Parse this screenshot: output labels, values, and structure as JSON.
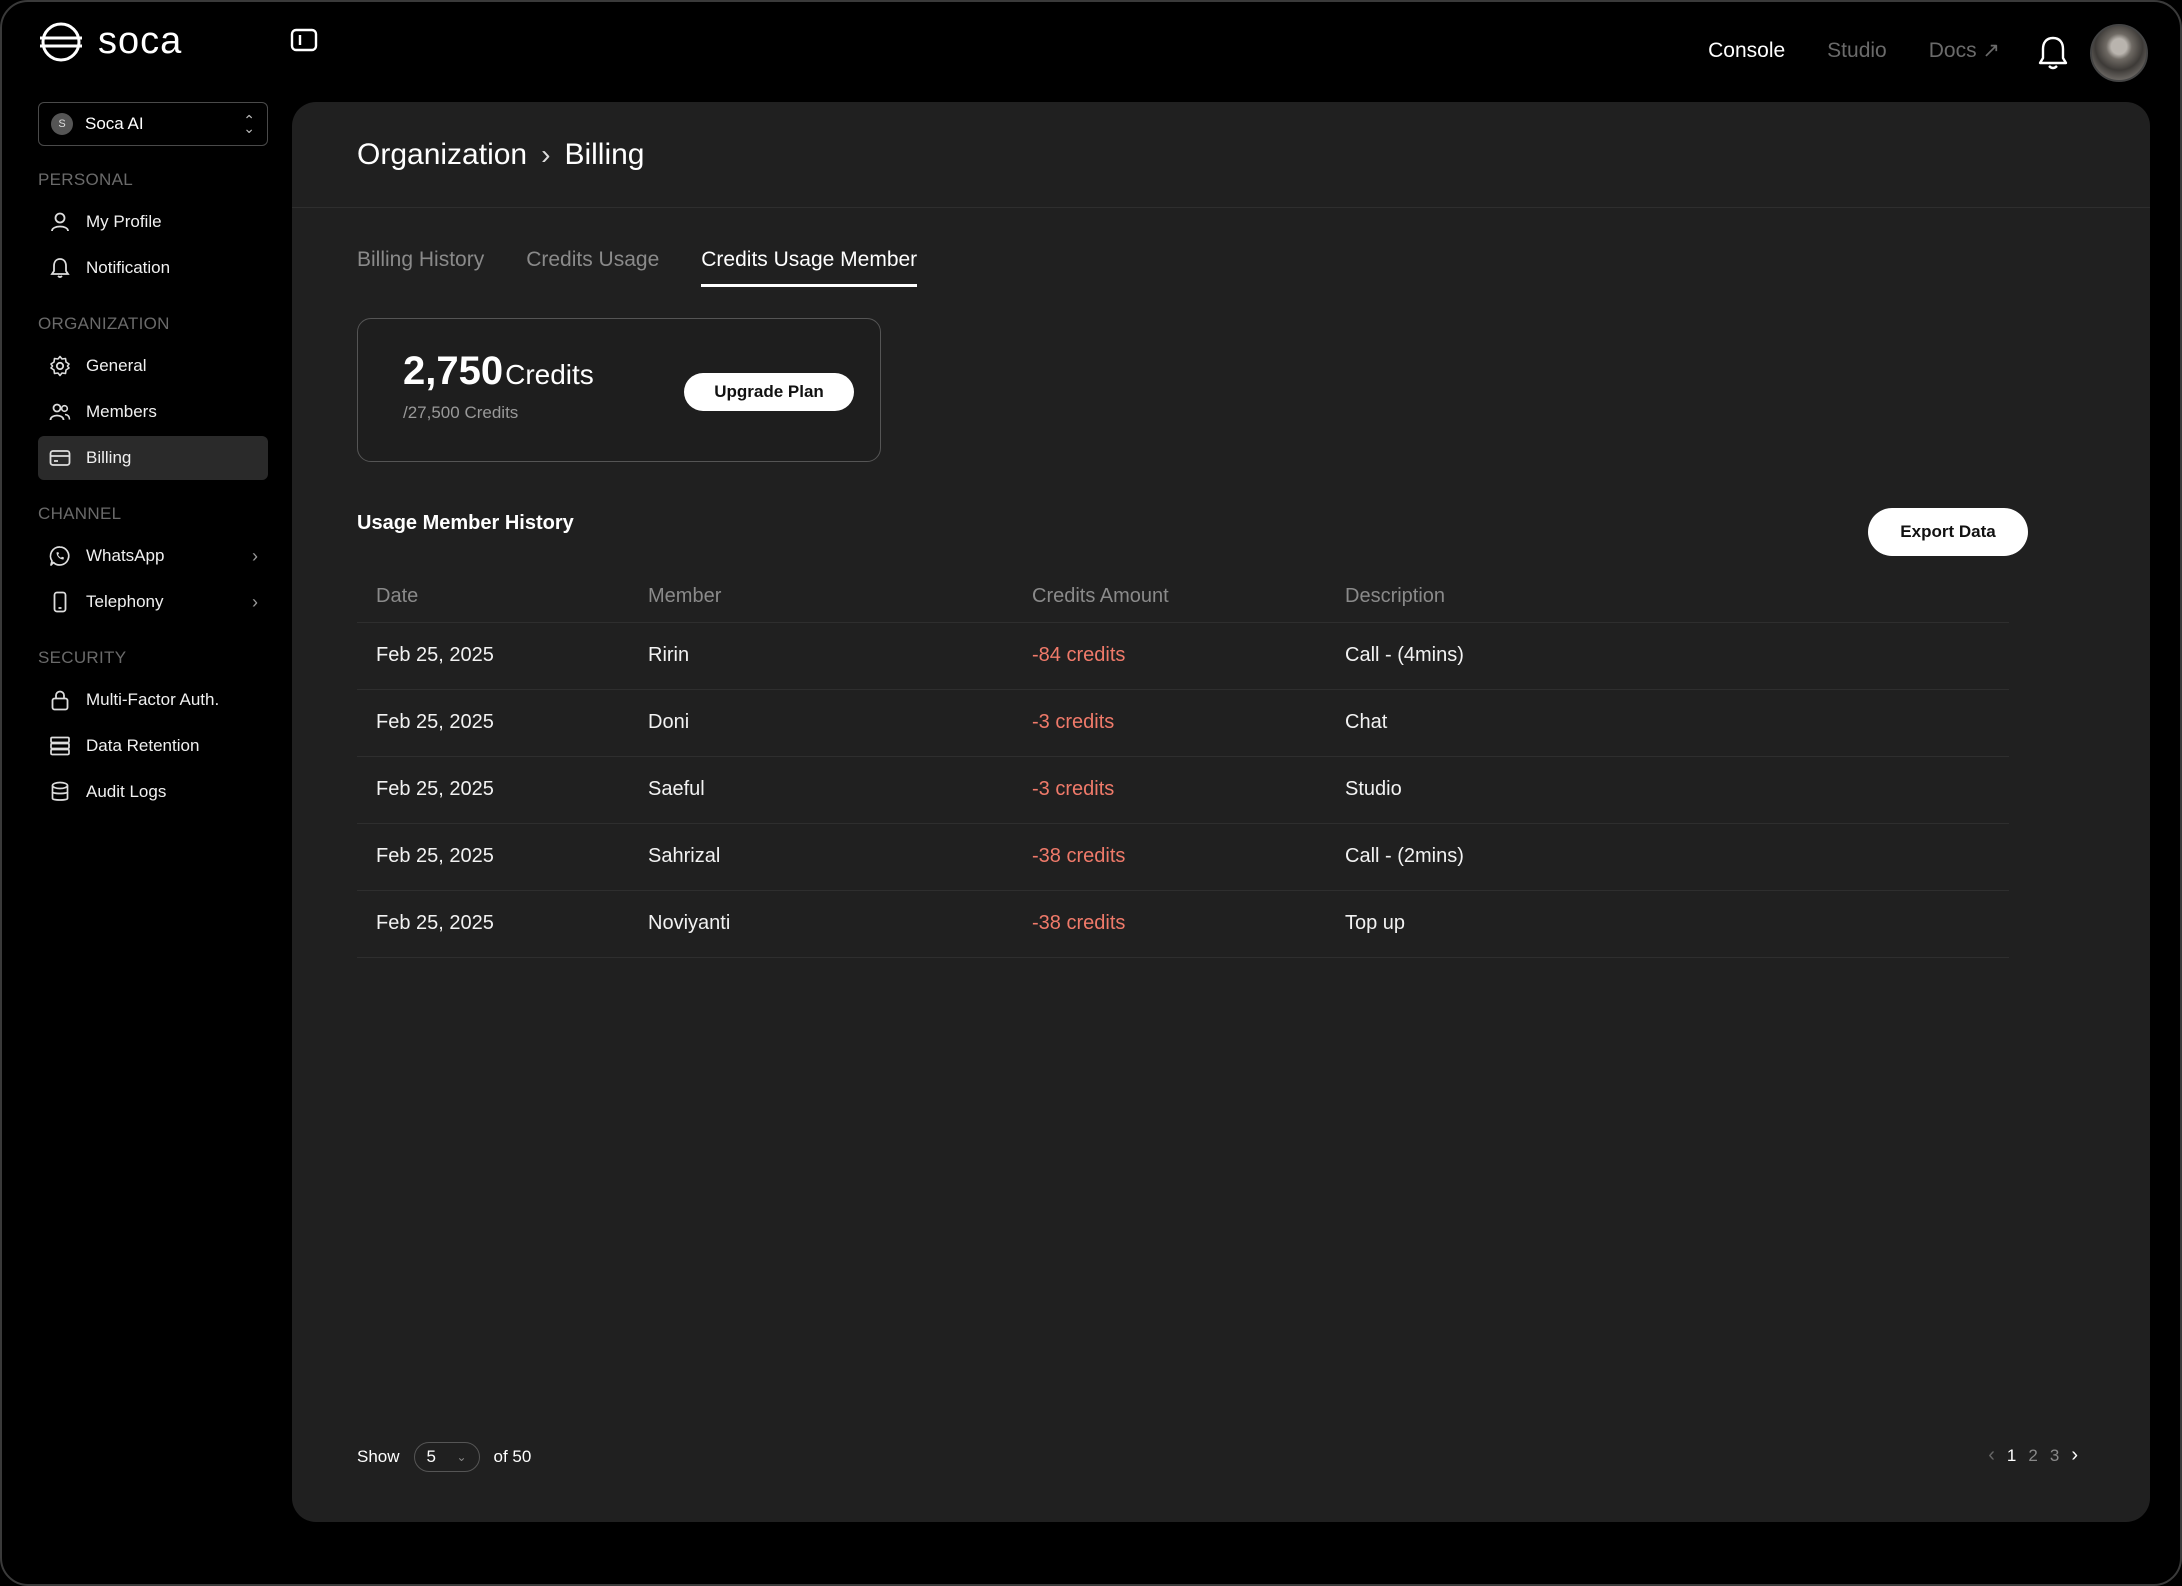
{
  "app": {
    "logo_text": "soca"
  },
  "topnav": {
    "console": "Console",
    "studio": "Studio",
    "docs": "Docs ↗"
  },
  "org_selector": {
    "badge": "S",
    "name": "Soca AI"
  },
  "sidebar": {
    "personal_label": "PERSONAL",
    "personal": [
      {
        "label": "My Profile",
        "icon": "user-icon"
      },
      {
        "label": "Notification",
        "icon": "bell-icon"
      }
    ],
    "organization_label": "ORGANIZATION",
    "organization": [
      {
        "label": "General",
        "icon": "gear-icon"
      },
      {
        "label": "Members",
        "icon": "members-icon"
      },
      {
        "label": "Billing",
        "icon": "card-icon",
        "selected": true
      }
    ],
    "channel_label": "CHANNEL",
    "channel": [
      {
        "label": "WhatsApp",
        "icon": "whatsapp-icon"
      },
      {
        "label": "Telephony",
        "icon": "phone-icon"
      }
    ],
    "security_label": "SECURITY",
    "security": [
      {
        "label": "Multi-Factor Auth.",
        "icon": "lock-icon"
      },
      {
        "label": "Data Retention",
        "icon": "server-icon"
      },
      {
        "label": "Audit Logs",
        "icon": "database-icon"
      }
    ]
  },
  "header": {
    "crumb_parent": "Organization",
    "crumb_current": "Billing"
  },
  "tabs": [
    {
      "label": "Billing History",
      "active": false
    },
    {
      "label": "Credits Usage",
      "active": false
    },
    {
      "label": "Credits Usage Member",
      "active": true
    }
  ],
  "credits": {
    "amount": "2,750",
    "unit": "Credits",
    "limit": "/27,500 Credits",
    "upgrade_label": "Upgrade Plan"
  },
  "history": {
    "title": "Usage Member History",
    "export_label": "Export Data",
    "columns": [
      "Date",
      "Member",
      "Credits Amount",
      "Description"
    ],
    "rows": [
      {
        "date": "Feb 25, 2025",
        "member": "Ririn",
        "amount": "-84 credits",
        "description": "Call - (4mins)"
      },
      {
        "date": "Feb 25, 2025",
        "member": "Doni",
        "amount": "-3 credits",
        "description": "Chat"
      },
      {
        "date": "Feb 25, 2025",
        "member": "Saeful",
        "amount": "-3 credits",
        "description": "Studio"
      },
      {
        "date": "Feb 25, 2025",
        "member": "Sahrizal",
        "amount": "-38 credits",
        "description": "Call - (2mins)"
      },
      {
        "date": "Feb 25, 2025",
        "member": "Noviyanti",
        "amount": "-38 credits",
        "description": "Top up"
      }
    ]
  },
  "footer": {
    "show_label": "Show",
    "page_size": "5",
    "of_label": "of 50",
    "pages": [
      "1",
      "2",
      "3"
    ],
    "current_page": "1"
  },
  "colors": {
    "negative_amount": "#f07a6a",
    "panel_bg": "#202020",
    "app_bg": "#000000"
  }
}
